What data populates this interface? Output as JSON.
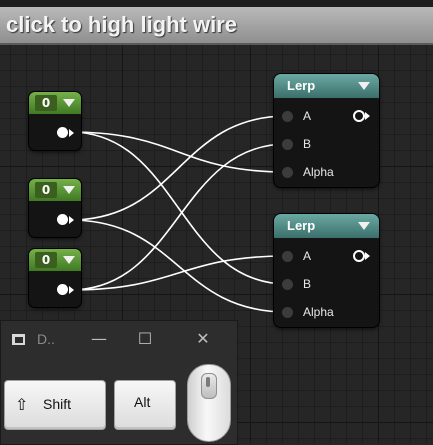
{
  "banner": {
    "text": "click to high light wire"
  },
  "const_nodes": [
    {
      "value": "0"
    },
    {
      "value": "0"
    },
    {
      "value": "0"
    }
  ],
  "lerp_nodes": [
    {
      "title": "Lerp",
      "inputs": [
        "A",
        "B",
        "Alpha"
      ]
    },
    {
      "title": "Lerp",
      "inputs": [
        "A",
        "B",
        "Alpha"
      ]
    }
  ],
  "key_dialog": {
    "title": "D..",
    "minimize": "—",
    "maximize": "☐",
    "close": "✕",
    "keys": {
      "shift": "Shift",
      "shift_symbol": "⇧",
      "alt": "Alt"
    }
  },
  "colors": {
    "const_header": "#5a9a36",
    "lerp_header": "#5a9590",
    "wire": "#ffffff",
    "banner": "#a6a6a6"
  }
}
